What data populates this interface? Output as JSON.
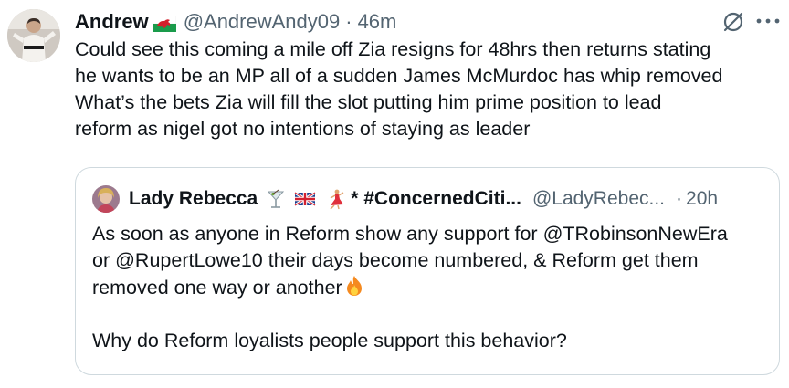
{
  "tweet": {
    "author": {
      "name": "Andrew",
      "flag": "wales-flag",
      "handle": "@AndrewAndy09",
      "dot": "·",
      "time": "46m"
    },
    "icons": {
      "grok": "grok-icon",
      "more": "more-options-icon"
    },
    "body_lines": [
      "Could see this coming a mile off Zia resigns for 48hrs then returns stating",
      "he wants to be an MP all of a sudden James McMurdoc has whip removed",
      "What’s the bets  Zia will fill the slot putting him prime position to lead",
      "reform as nigel got no intentions of staying as leader"
    ]
  },
  "quote": {
    "author": {
      "name": "Lady Rebecca",
      "emojis": [
        "cocktail-glass-emoji",
        "uk-flag-emoji",
        "dancer-emoji"
      ],
      "title": "* #ConcernedCiti...",
      "handle": "@LadyRebec...",
      "dot": "·",
      "time": "20h"
    },
    "body_lines": [
      "As soon as anyone in Reform show any support for @TRobinsonNewEra",
      "or @RupertLowe10 their days become numbered, & Reform get them",
      "removed one way or another"
    ],
    "body_emoji": "fire-emoji",
    "body_last": "Why do Reform loyalists people support this behavior?"
  }
}
